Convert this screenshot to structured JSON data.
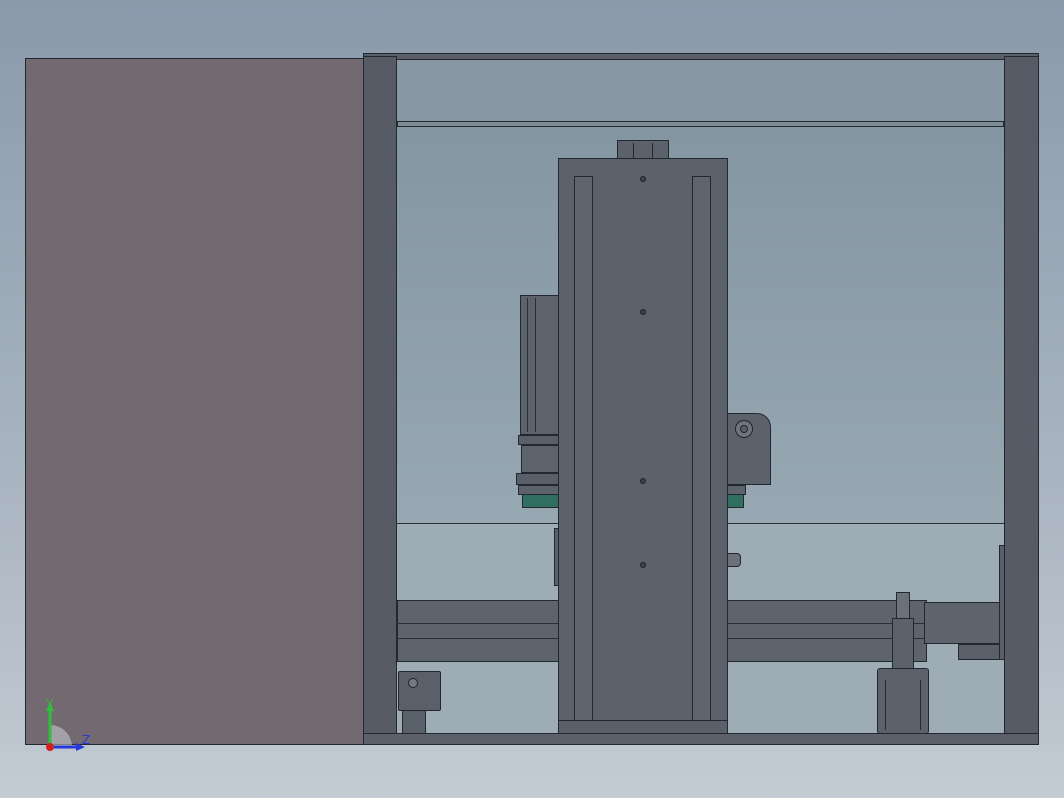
{
  "viewport": {
    "background_top": "#8a9aab",
    "background_bottom": "#c3cbd3"
  },
  "model": {
    "side_panel_color": "#736970",
    "frame_color": "#565b66",
    "inner_panel_color": "#8a9aa6",
    "column_color": "#5c626b",
    "accent_green": "#2f6e60"
  },
  "triad": {
    "y_label": "Y",
    "z_label": "Z",
    "y_color": "#2fbf3a",
    "z_color": "#2838d8",
    "origin_color": "#d02020"
  }
}
